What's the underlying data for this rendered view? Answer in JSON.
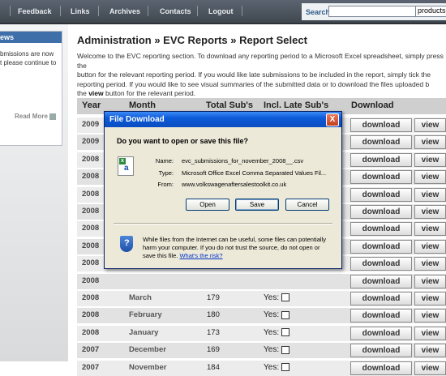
{
  "nav": {
    "items": [
      "Feedback",
      "Links",
      "Archives",
      "Contacts",
      "Logout"
    ],
    "search_label": "Search",
    "search_value": "",
    "search_scope": "products"
  },
  "sidebar": {
    "news_title": "ews",
    "news_text": "bmissions are now\nt please continue to",
    "read_more": "Read More"
  },
  "main": {
    "title": "Administration » EVC Reports » Report Select",
    "intro_1": "Welcome to the EVC reporting section. To download any reporting period to a Microsoft Excel spreadsheet, simply press the",
    "intro_2": "button for the relevant reporting period. If you would like late submissions to be included in the report, simply tick the",
    "intro_3": "reporting period. If you would like to see visual summaries of the submitted data or to download the files uploaded b",
    "intro_4_prefix": "the ",
    "intro_4_view": "view",
    "intro_4_suffix": " button for the relevant period.",
    "headers": [
      "Year",
      "Month",
      "Total Sub's",
      "Incl. Late Sub's",
      "Download"
    ],
    "rows": [
      {
        "year": "2009",
        "month": "",
        "total": "",
        "late": ""
      },
      {
        "year": "2009",
        "month": "",
        "total": "",
        "late": ""
      },
      {
        "year": "2008",
        "month": "",
        "total": "",
        "late": ""
      },
      {
        "year": "2008",
        "month": "",
        "total": "",
        "late": ""
      },
      {
        "year": "2008",
        "month": "",
        "total": "",
        "late": ""
      },
      {
        "year": "2008",
        "month": "",
        "total": "",
        "late": ""
      },
      {
        "year": "2008",
        "month": "",
        "total": "",
        "late": ""
      },
      {
        "year": "2008",
        "month": "",
        "total": "",
        "late": ""
      },
      {
        "year": "2008",
        "month": "",
        "total": "",
        "late": ""
      },
      {
        "year": "2008",
        "month": "",
        "total": "",
        "late": ""
      },
      {
        "year": "2008",
        "month": "March",
        "total": "179",
        "late": "Yes:"
      },
      {
        "year": "2008",
        "month": "February",
        "total": "180",
        "late": "Yes:"
      },
      {
        "year": "2008",
        "month": "January",
        "total": "173",
        "late": "Yes:"
      },
      {
        "year": "2007",
        "month": "December",
        "total": "169",
        "late": "Yes:"
      },
      {
        "year": "2007",
        "month": "November",
        "total": "184",
        "late": "Yes:"
      }
    ],
    "download_label": "download",
    "view_label": "view"
  },
  "dialog": {
    "title": "File Download",
    "close": "X",
    "question": "Do you want to open or save this file?",
    "name_label": "Name:",
    "name_value": "evc_submissions_for_november_2008__.csv",
    "type_label": "Type:",
    "type_value": "Microsoft Office Excel Comma Separated Values Fil...",
    "from_label": "From:",
    "from_value": "www.volkswagenaftersalestoolkit.co.uk",
    "open_label": "Open",
    "save_label": "Save",
    "cancel_label": "Cancel",
    "warning_text": "While files from the Internet can be useful, some files can potentially harm your computer. If you do not trust the source, do not open or save this file.",
    "risk_link": "What's the risk?"
  }
}
